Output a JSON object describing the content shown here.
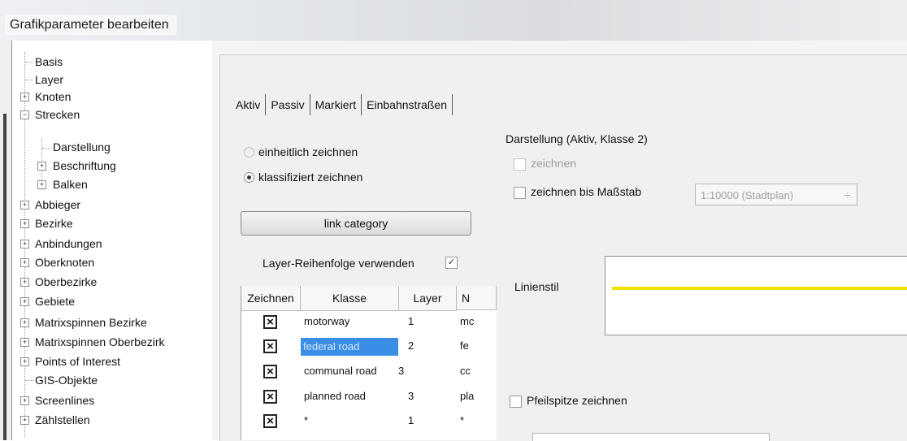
{
  "window": {
    "title": "Grafikparameter bearbeiten"
  },
  "tree": {
    "items": [
      {
        "label": "Basis",
        "level": 0,
        "expandable": false
      },
      {
        "label": "Layer",
        "level": 0,
        "expandable": false
      },
      {
        "label": "Knoten",
        "level": 0,
        "expandable": true,
        "expanded": false
      },
      {
        "label": "Strecken",
        "level": 0,
        "expandable": true,
        "expanded": true
      },
      {
        "label": "Darstellung",
        "level": 1,
        "expandable": false
      },
      {
        "label": "Beschriftung",
        "level": 1,
        "expandable": true,
        "expanded": false
      },
      {
        "label": "Balken",
        "level": 1,
        "expandable": true,
        "expanded": false
      },
      {
        "label": "Abbieger",
        "level": 0,
        "expandable": true,
        "expanded": false
      },
      {
        "label": "Bezirke",
        "level": 0,
        "expandable": true,
        "expanded": false
      },
      {
        "label": "Anbindungen",
        "level": 0,
        "expandable": true,
        "expanded": false
      },
      {
        "label": "Oberknoten",
        "level": 0,
        "expandable": true,
        "expanded": false
      },
      {
        "label": "Oberbezirke",
        "level": 0,
        "expandable": true,
        "expanded": false
      },
      {
        "label": "Gebiete",
        "level": 0,
        "expandable": true,
        "expanded": false
      },
      {
        "label": "Matrixspinnen Bezirke",
        "level": 0,
        "expandable": true,
        "expanded": false
      },
      {
        "label": "Matrixspinnen Oberbezirk",
        "level": 0,
        "expandable": true,
        "expanded": false
      },
      {
        "label": "Points of Interest",
        "level": 0,
        "expandable": true,
        "expanded": false
      },
      {
        "label": "GIS-Objekte",
        "level": 0,
        "expandable": false
      },
      {
        "label": "Screenlines",
        "level": 0,
        "expandable": true,
        "expanded": false
      },
      {
        "label": "Zählstellen",
        "level": 0,
        "expandable": true,
        "expanded": false
      }
    ]
  },
  "tabs": [
    "Aktiv",
    "Passiv",
    "Markiert",
    "Einbahnstraßen"
  ],
  "mode": {
    "options": [
      "einheitlich zeichnen",
      "klassifiziert zeichnen"
    ],
    "selected": 1,
    "category_button": "link category",
    "layer_order_label": "Layer-Reihenfolge verwenden",
    "layer_order_checked": true
  },
  "table": {
    "headers": [
      "Zeichnen",
      "Klasse",
      "Layer",
      "N"
    ],
    "rows": [
      {
        "draw": true,
        "klasse": "motorway",
        "layer": "1",
        "name": "mc"
      },
      {
        "draw": true,
        "klasse": "federal road",
        "layer": "2",
        "name": "fe",
        "selected": true
      },
      {
        "draw": true,
        "klasse": "communal road",
        "layer": "3",
        "name": "cc"
      },
      {
        "draw": true,
        "klasse": "planned road",
        "layer": "3",
        "name": "pla"
      },
      {
        "draw": true,
        "klasse": "*",
        "layer": "1",
        "name": "*"
      }
    ]
  },
  "display": {
    "group_title": "Darstellung (Aktiv, Klasse 2)",
    "draw_label": "zeichnen",
    "draw_until_label": "zeichnen bis Maßstab",
    "scale_value": "1:10000 (Stadtplan)",
    "line_style_label": "Linienstil",
    "line_color": "#f0e000",
    "arrow_label": "Pfeilspitze zeichnen"
  },
  "colors": {
    "selection": "#3b8ee6"
  }
}
